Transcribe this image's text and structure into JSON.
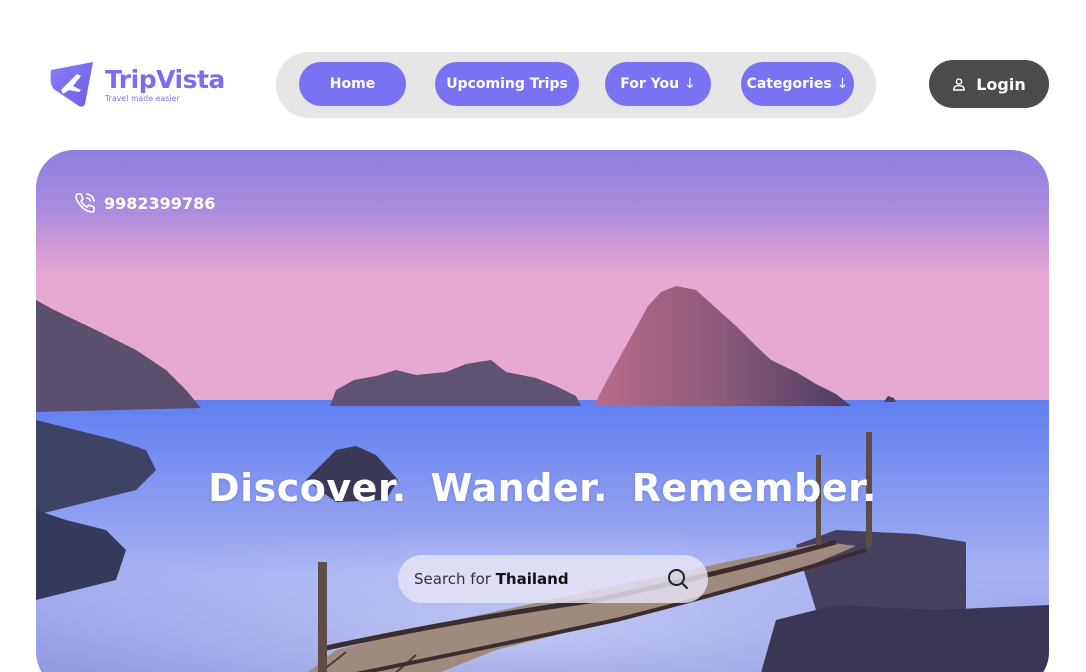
{
  "brand": {
    "name": "TripVista",
    "tagline": "Travel made easier",
    "logo_icon": "airplane-icon",
    "accent_color": "#7a72f2"
  },
  "nav": {
    "items": [
      {
        "label": "Home",
        "arrow": ""
      },
      {
        "label": "Upcoming Trips",
        "arrow": ""
      },
      {
        "label": "For You",
        "arrow": "↓"
      },
      {
        "label": "Categories",
        "arrow": "↓"
      }
    ]
  },
  "login": {
    "label": "Login",
    "icon": "user-icon"
  },
  "hero": {
    "phone": "9982399786",
    "phone_icon": "phone-call-icon",
    "headline": "Discover. Wander. Remember.",
    "search": {
      "prefix": "Search for",
      "term": "Thailand",
      "icon": "search-icon"
    }
  }
}
